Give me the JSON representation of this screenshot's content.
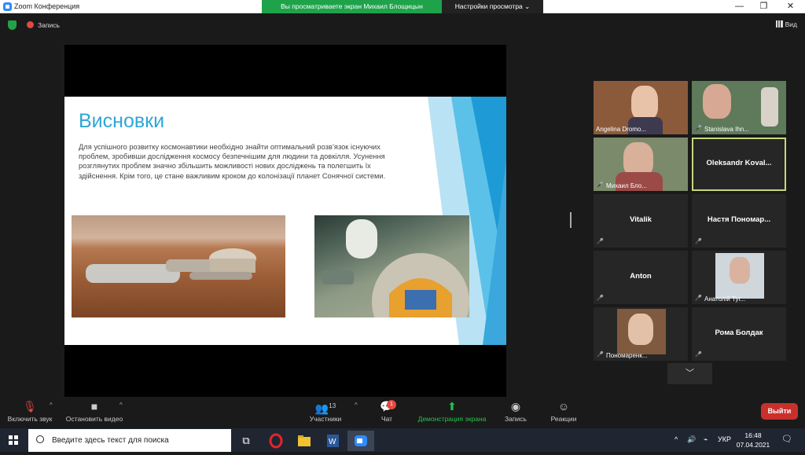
{
  "window": {
    "title": "Zoom Конференция",
    "min": "—",
    "max": "❐",
    "close": "✕"
  },
  "banner": {
    "text": "Вы просматриваете экран Михаил Блощицын",
    "view_options": "Настройки просмотра ⌄"
  },
  "topbar": {
    "record_label": "Запись",
    "view_label": "Вид"
  },
  "slide": {
    "title": "Висновки",
    "body": "Для успішного розвитку космонавтики необхідно знайти оптимальний розв’язок існуючих проблем, зробивши дослідження космосу безпечнішим для людини та довкілля. Усунення розглянутих проблем значно збільшить можливості нових досліджень та полегшить їх здійснення. Крім того, це стане важливим кроком до колонізації планет Сонячної системи."
  },
  "participants": [
    {
      "name": "Angelina Dromo...",
      "video": true
    },
    {
      "name": "Stanislava Ihn...",
      "video": true
    },
    {
      "name": "Михаил Бло...",
      "video": true
    },
    {
      "name": "Oleksandr  Koval...",
      "video": false,
      "active": true
    },
    {
      "name": "Vitalik",
      "video": false
    },
    {
      "name": "Настя  Пономар...",
      "video": false
    },
    {
      "name": "Anton",
      "video": false
    },
    {
      "name": "Анатолій Туг...",
      "video": true
    },
    {
      "name": "Пономаренк...",
      "video": true
    },
    {
      "name": "Рома Болдак",
      "video": false
    }
  ],
  "gallery": {
    "next_icon": "chevron-down-icon"
  },
  "toolbar": {
    "unmute": "Включить звук",
    "stop_video": "Остановить видео",
    "participants": "Участники",
    "participants_count": "13",
    "chat": "Чат",
    "chat_badge": "1",
    "share": "Демонстрация экрана",
    "record": "Запись",
    "reactions": "Реакции",
    "leave": "Выйти"
  },
  "taskbar": {
    "search_placeholder": "Введите здесь текст для поиска",
    "lang": "УКР",
    "time": "16:48",
    "date": "07.04.2021"
  },
  "colors": {
    "accent": "#2fa6d6",
    "banner": "#1ea34b",
    "leave": "#c9302c",
    "mute": "#e14a3f"
  }
}
